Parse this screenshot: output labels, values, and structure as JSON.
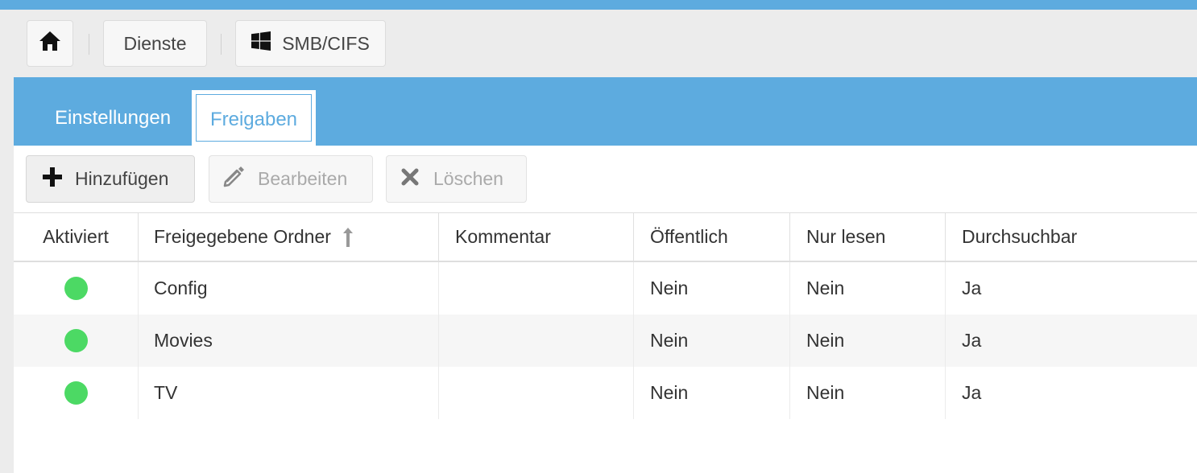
{
  "breadcrumb": {
    "home_icon": "home-icon",
    "items": [
      {
        "label": "Dienste"
      },
      {
        "label": "SMB/CIFS",
        "icon": "windows-icon"
      }
    ]
  },
  "tabs": [
    {
      "label": "Einstellungen",
      "active": false
    },
    {
      "label": "Freigaben",
      "active": true
    }
  ],
  "toolbar": {
    "add": {
      "label": "Hinzufügen",
      "icon": "plus-icon",
      "enabled": true
    },
    "edit": {
      "label": "Bearbeiten",
      "icon": "pencil-icon",
      "enabled": false
    },
    "delete": {
      "label": "Löschen",
      "icon": "close-icon",
      "enabled": false
    }
  },
  "table": {
    "columns": [
      "Aktiviert",
      "Freigegebene Ordner",
      "Kommentar",
      "Öffentlich",
      "Nur lesen",
      "Durchsuchbar"
    ],
    "sort_icon": "sort-ascending-icon",
    "rows": [
      {
        "enabled": true,
        "folder": "Config",
        "comment": "",
        "public": "Nein",
        "readonly": "Nein",
        "browsable": "Ja"
      },
      {
        "enabled": true,
        "folder": "Movies",
        "comment": "",
        "public": "Nein",
        "readonly": "Nein",
        "browsable": "Ja"
      },
      {
        "enabled": true,
        "folder": "TV",
        "comment": "",
        "public": "Nein",
        "readonly": "Nein",
        "browsable": "Ja"
      }
    ]
  },
  "colors": {
    "accent": "#5dabdf",
    "status_enabled": "#4cd964",
    "background": "#ececec"
  }
}
